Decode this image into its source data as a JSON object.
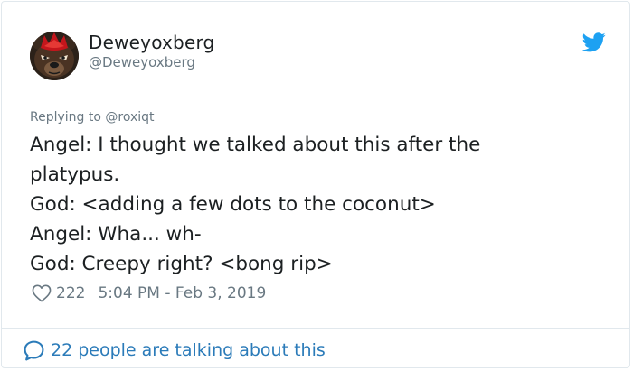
{
  "tweet": {
    "author": {
      "display_name": "Deweyoxberg",
      "handle": "@Deweyoxberg",
      "avatar_icon": "bear-avatar"
    },
    "brand_icon": "twitter-bird-icon",
    "reply_prefix": "Replying to ",
    "reply_to": "@roxiqt",
    "text_lines": [
      "Angel: I thought we talked about this after the",
      "platypus.",
      "God: <adding a few dots to the coconut>",
      "Angel: Wha... wh-",
      "God: Creepy right? <bong rip>"
    ],
    "likes": "222",
    "timestamp": "5:04 PM - Feb 3, 2019"
  },
  "footer": {
    "talking_text": "22 people are talking about this"
  },
  "colors": {
    "text": "#1c2022",
    "secondary": "#697882",
    "link": "#2b7bb9",
    "twitter_blue": "#1da1f2",
    "border": "#e1e8ed"
  }
}
